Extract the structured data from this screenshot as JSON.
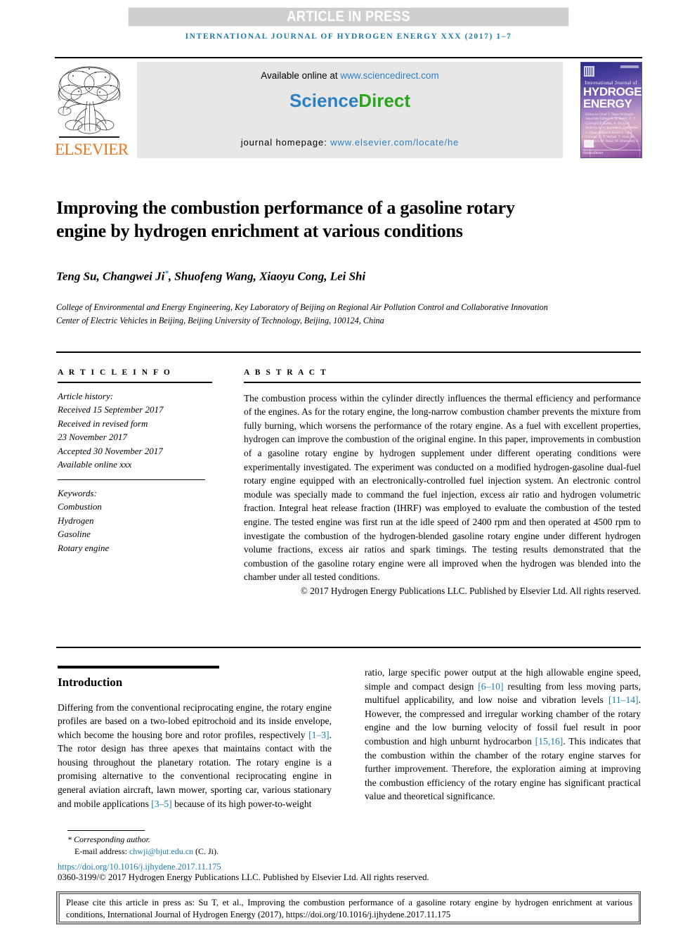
{
  "banner": {
    "text": "ARTICLE IN PRESS"
  },
  "running_head": {
    "text": "INTERNATIONAL JOURNAL OF HYDROGEN ENERGY XXX (2017) 1–7"
  },
  "masthead": {
    "publisher": "ELSEVIER",
    "available_prefix": "Available online at ",
    "available_url": "www.sciencedirect.com",
    "sciencedirect_first": "Science",
    "sciencedirect_second": "Direct",
    "homepage_label": "journal homepage: ",
    "homepage_url": "www.elsevier.com/locate/he",
    "cover": {
      "line_small": "International Journal of",
      "line1": "HYDROGEN",
      "line2": "ENERGY",
      "names": "Editor-in-Chief\nT. Nejat Veziroglu\nAssociate Editors\nS. A. Sherif, D. Y. Goswami\nF. Barbir, A. Dicks\nH. Ibrahim, A. Al-Kayiem\nG. Gahleitner, S. Dunn,\nEditorial Board\nT. Ogi, Gurman, G. T. Verfaal,\nV. Shah, M. Jajcowicz, M. Balat,\nM. Mahmood, K. Otsuka",
      "footer": "ScienceDirect"
    }
  },
  "article": {
    "title": "Improving the combustion performance of a gasoline rotary engine by hydrogen enrichment at various conditions",
    "authors": "Teng Su, Changwei Ji",
    "authors_rest": ", Shuofeng Wang, Xiaoyu Cong, Lei Shi",
    "corresponding_marker": "*",
    "affiliation": "College of Environmental and Energy Engineering, Key Laboratory of Beijing on Regional Air Pollution Control and Collaborative Innovation Center of Electric Vehicles in Beijing, Beijing University of Technology, Beijing, 100124, China"
  },
  "article_info": {
    "heading": "A R T I C L E  I N F O",
    "history_label": "Article history:",
    "received": "Received 15 September 2017",
    "revised_label": "Received in revised form",
    "revised_date": "23 November 2017",
    "accepted": "Accepted 30 November 2017",
    "available": "Available online xxx",
    "keywords_label": "Keywords:",
    "keywords": [
      "Combustion",
      "Hydrogen",
      "Gasoline",
      "Rotary engine"
    ]
  },
  "abstract": {
    "heading": "A B S T R A C T",
    "body": "The combustion process within the cylinder directly influences the thermal efficiency and performance of the engines. As for the rotary engine, the long-narrow combustion chamber prevents the mixture from fully burning, which worsens the performance of the rotary engine. As a fuel with excellent properties, hydrogen can improve the combustion of the original engine. In this paper, improvements in combustion of a gasoline rotary engine by hydrogen supplement under different operating conditions were experimentally investigated. The experiment was conducted on a modified hydrogen-gasoline dual-fuel rotary engine equipped with an electronically-controlled fuel injection system. An electronic control module was specially made to command the fuel injection, excess air ratio and hydrogen volumetric fraction. Integral heat release fraction (IHRF) was employed to evaluate the combustion of the tested engine. The tested engine was first run at the idle speed of 2400 rpm and then operated at 4500 rpm to investigate the combustion of the hydrogen-blended gasoline rotary engine under different hydrogen volume fractions, excess air ratios and spark timings. The testing results demonstrated that the combustion of the gasoline rotary engine were all improved when the hydrogen was blended into the chamber under all tested conditions.",
    "copyright": "© 2017 Hydrogen Energy Publications LLC. Published by Elsevier Ltd. All rights reserved."
  },
  "introduction": {
    "heading": "Introduction",
    "left_p1_a": "Differing from the conventional reciprocating engine, the rotary engine profiles are based on a two-lobed epitrochoid and its inside envelope, which become the housing bore and rotor profiles, respectively ",
    "left_ref1": "[1–3]",
    "left_p1_b": ". The rotor design has three apexes that maintains contact with the housing throughout the planetary rotation. The rotary engine is a promising alternative to the conventional reciprocating engine in general aviation aircraft, lawn mower, sporting car, various stationary and mobile applications ",
    "left_ref2": "[3–5]",
    "left_p1_c": " because of its high power-to-weight",
    "right_p1_a": "ratio, large specific power output at the high allowable engine speed, simple and compact design ",
    "right_ref1": "[6–10]",
    "right_p1_b": " resulting from less moving parts, multifuel applicability, and low noise and vibration levels ",
    "right_ref2": "[11–14]",
    "right_p1_c": ". However, the compressed and irregular working chamber of the rotary engine and the low burning velocity of fossil fuel result in poor combustion and high unburnt hydrocarbon ",
    "right_ref3": "[15,16]",
    "right_p1_d": ". This indicates that the combustion within the chamber of the rotary engine starves for further improvement. Therefore, the exploration aiming at improving the combustion efficiency of the rotary engine has significant practical value and theoretical significance."
  },
  "footer": {
    "corresponding_star": "*",
    "corresponding_label": " Corresponding author.",
    "email_label": "E-mail address: ",
    "email": "chwji@bjut.edu.cn",
    "email_suffix": " (C. Ji).",
    "doi": "https://doi.org/10.1016/j.ijhydene.2017.11.175",
    "issn_line": "0360-3199/© 2017 Hydrogen Energy Publications LLC. Published by Elsevier Ltd. All rights reserved."
  },
  "cite_box": {
    "text": "Please cite this article in press as: Su T, et al., Improving the combustion performance of a gasoline rotary engine by hydrogen enrichment at various conditions, International Journal of Hydrogen Energy (2017), https://doi.org/10.1016/j.ijhydene.2017.11.175"
  },
  "colors": {
    "banner_bg": "#cfcfcf",
    "journal_blue": "#1a7aad",
    "link_blue": "#2b7fc4",
    "sciencedirect_green": "#2aa61c",
    "elsevier_orange": "#E87722",
    "sd_box_bg": "#e7e7e7",
    "cite_box_bg": "#c8c8c8"
  }
}
